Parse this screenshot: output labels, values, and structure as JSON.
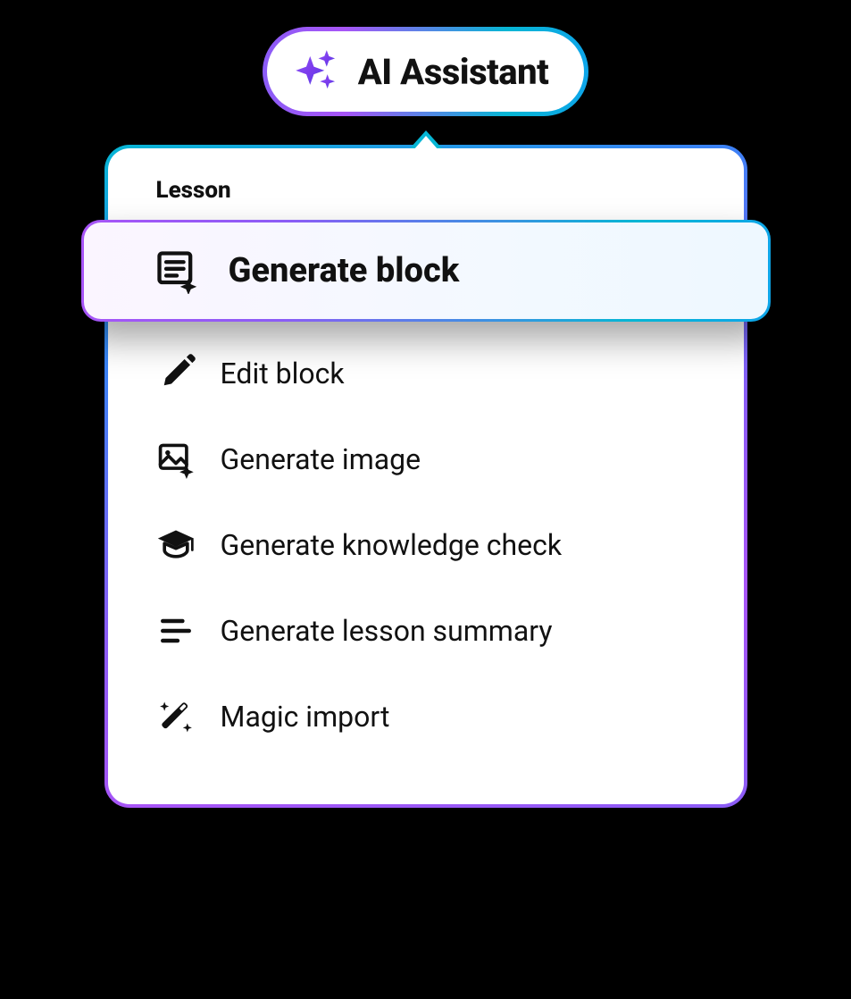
{
  "header": {
    "title": "AI Assistant"
  },
  "panel": {
    "section_label": "Lesson",
    "items": [
      {
        "label": "Generate block",
        "icon": "block-sparkle-icon",
        "highlighted": true
      },
      {
        "label": "Edit block",
        "icon": "pencil-icon",
        "highlighted": false
      },
      {
        "label": "Generate image",
        "icon": "image-sparkle-icon",
        "highlighted": false
      },
      {
        "label": "Generate knowledge check",
        "icon": "graduation-cap-icon",
        "highlighted": false
      },
      {
        "label": "Generate lesson summary",
        "icon": "lines-icon",
        "highlighted": false
      },
      {
        "label": "Magic import",
        "icon": "magic-wand-icon",
        "highlighted": false
      }
    ]
  },
  "colors": {
    "gradient_purple": "#8b5cf6",
    "gradient_cyan": "#06b6d4",
    "gradient_pink": "#a855f7"
  }
}
